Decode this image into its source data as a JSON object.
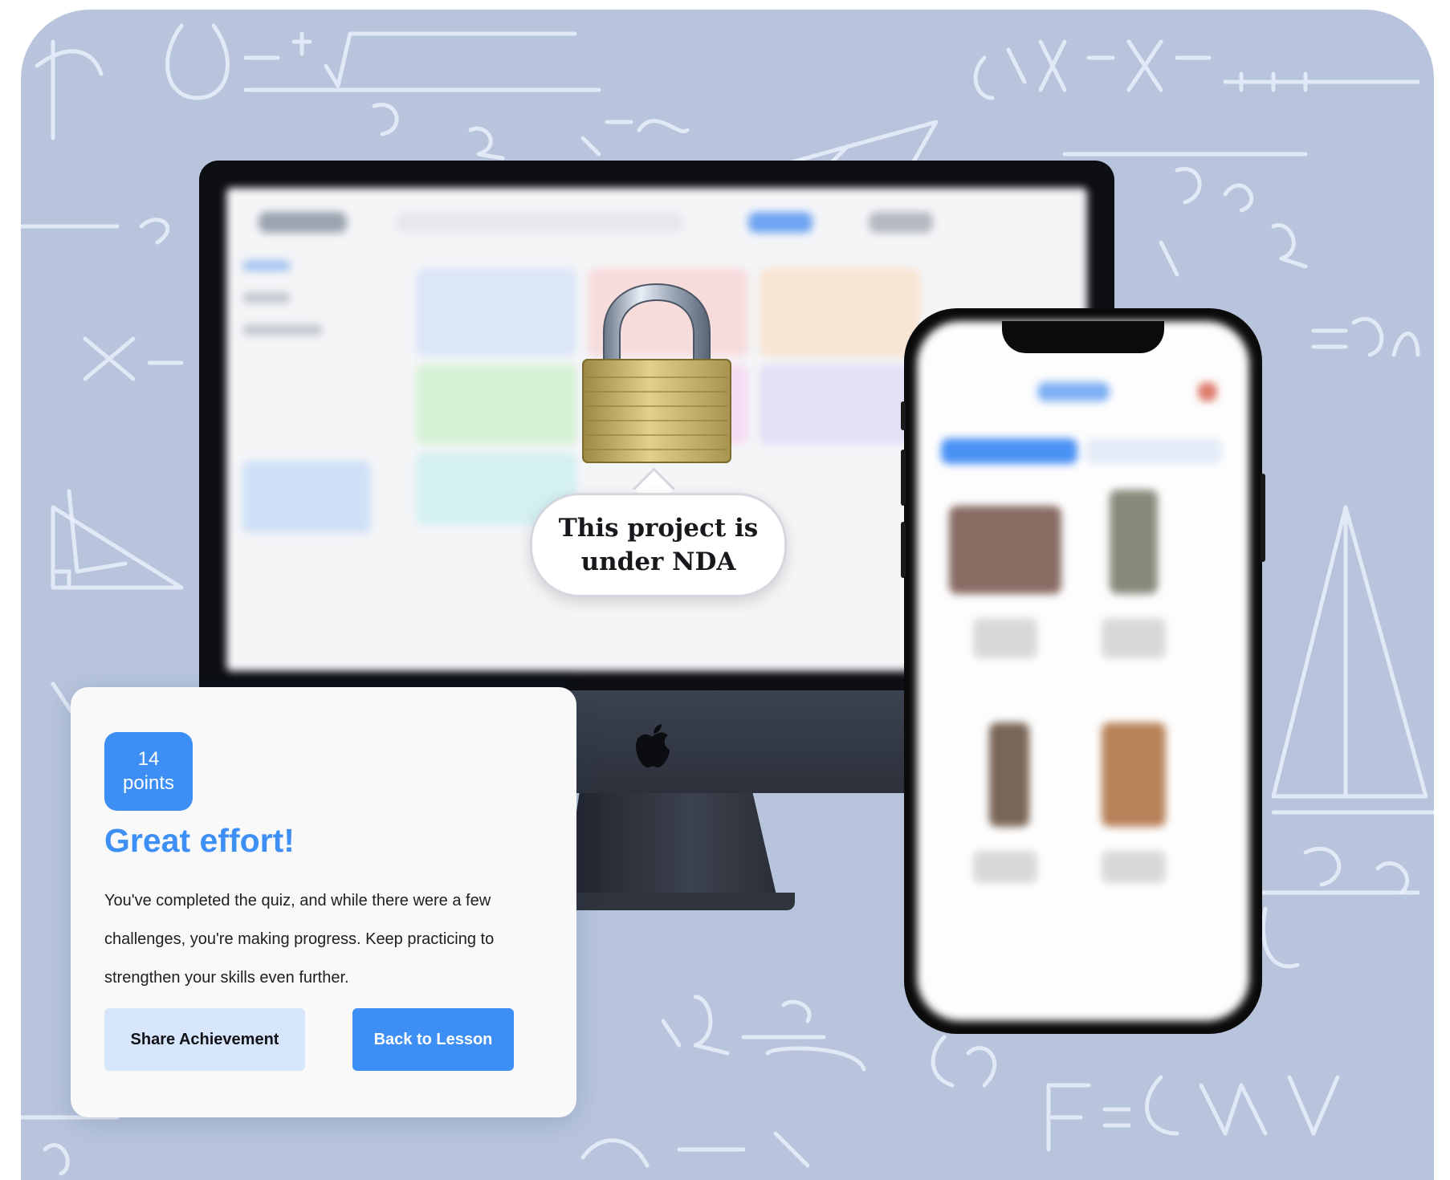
{
  "lock_bubble": {
    "text": "This project is under NDA"
  },
  "result_card": {
    "points_value": "14",
    "points_label": "points",
    "title": "Great effort!",
    "message": "You've completed the quiz, and while there were a few challenges, you're making progress. Keep practicing to strengthen your skills even further.",
    "share_label": "Share Achievement",
    "back_label": "Back to Lesson"
  },
  "colors": {
    "accent": "#3d8ef5",
    "accent_light": "#d8e6fb",
    "background": "#b7c4dc"
  },
  "icons": [
    "lock-icon",
    "apple-logo-icon"
  ]
}
